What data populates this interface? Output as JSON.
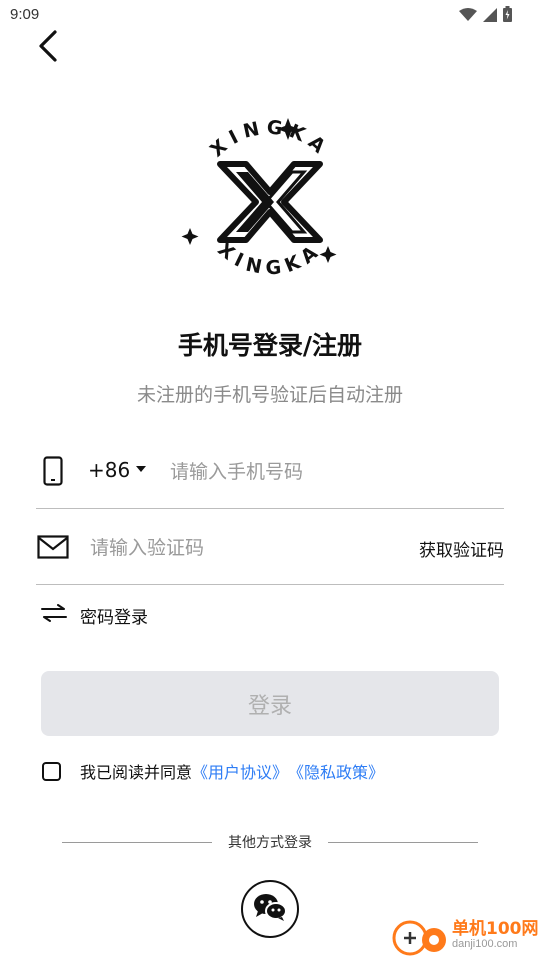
{
  "status_bar": {
    "time": "9:09"
  },
  "logo": {
    "brand_text": "XINGKA"
  },
  "header": {
    "title": "手机号登录/注册",
    "subtitle": "未注册的手机号验证后自动注册"
  },
  "phone": {
    "country_code": "+86",
    "placeholder": "请输入手机号码",
    "value": ""
  },
  "code": {
    "placeholder": "请输入验证码",
    "value": "",
    "get_code_label": "获取验证码"
  },
  "password_login": {
    "label": "密码登录"
  },
  "login_button": {
    "label": "登录"
  },
  "agreement": {
    "checked": false,
    "prefix": "我已阅读并同意",
    "user_agreement": "《用户协议》",
    "privacy_policy": "《隐私政策》"
  },
  "other_login": {
    "label": "其他方式登录"
  },
  "watermark": {
    "name": "单机100网",
    "domain": "danji100.com"
  },
  "colors": {
    "link": "#2e7df5",
    "login_bg": "#e5e6ea",
    "placeholder": "#9a9a9a"
  }
}
